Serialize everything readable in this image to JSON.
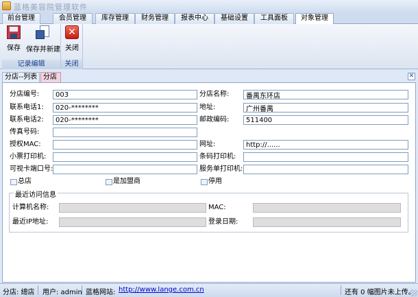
{
  "window": {
    "title": "蓝格美容院管理软件"
  },
  "tabs": [
    "前台管理",
    "会员管理",
    "库存管理",
    "财务管理",
    "报表中心",
    "基础设置",
    "工具面板",
    "对象管理"
  ],
  "ribbon": {
    "groups": [
      {
        "label": "记录编辑",
        "buttons": [
          "保存",
          "保存并新建"
        ]
      },
      {
        "label": "关闭",
        "buttons": [
          "关闭"
        ]
      }
    ]
  },
  "doc_tabs": [
    "分店--列表",
    "分店"
  ],
  "form": {
    "store_no_label": "分店编号:",
    "store_no": "003",
    "store_name_label": "分店名称:",
    "store_name": "番禺东环店",
    "phone1_label": "联系电话1:",
    "phone1": "020-********",
    "address_label": "地址:",
    "address": "广州番禺",
    "phone2_label": "联系电话2:",
    "phone2": "020-********",
    "postcode_label": "邮政编码:",
    "postcode": "511400",
    "fax_label": "传真号码:",
    "fax": "",
    "mac_label": "授权MAC:",
    "mac": "",
    "website_label": "网址:",
    "website": "http://......",
    "receipt_printer_label": "小票打印机:",
    "receipt_printer": "",
    "barcode_printer_label": "条码打印机:",
    "barcode_printer": "",
    "card_port_label": "可视卡端口号:",
    "card_port": "",
    "service_printer_label": "服务单打印机:",
    "service_printer": "",
    "hq_label": "总店",
    "franchise_label": "是加盟商",
    "disabled_label": "停用"
  },
  "recent": {
    "legend": "最近访问信息",
    "computer_label": "计算机名称:",
    "mac_label": "MAC:",
    "ip_label": "最近IP地址:",
    "login_label": "登录日期:"
  },
  "status": {
    "store": "分店: 總店",
    "user": "用户: admin",
    "site_label": "蓝格网站:",
    "site_url": "http://www.lange.com.cn",
    "upload": "还有 0 幅图片未上传。"
  }
}
